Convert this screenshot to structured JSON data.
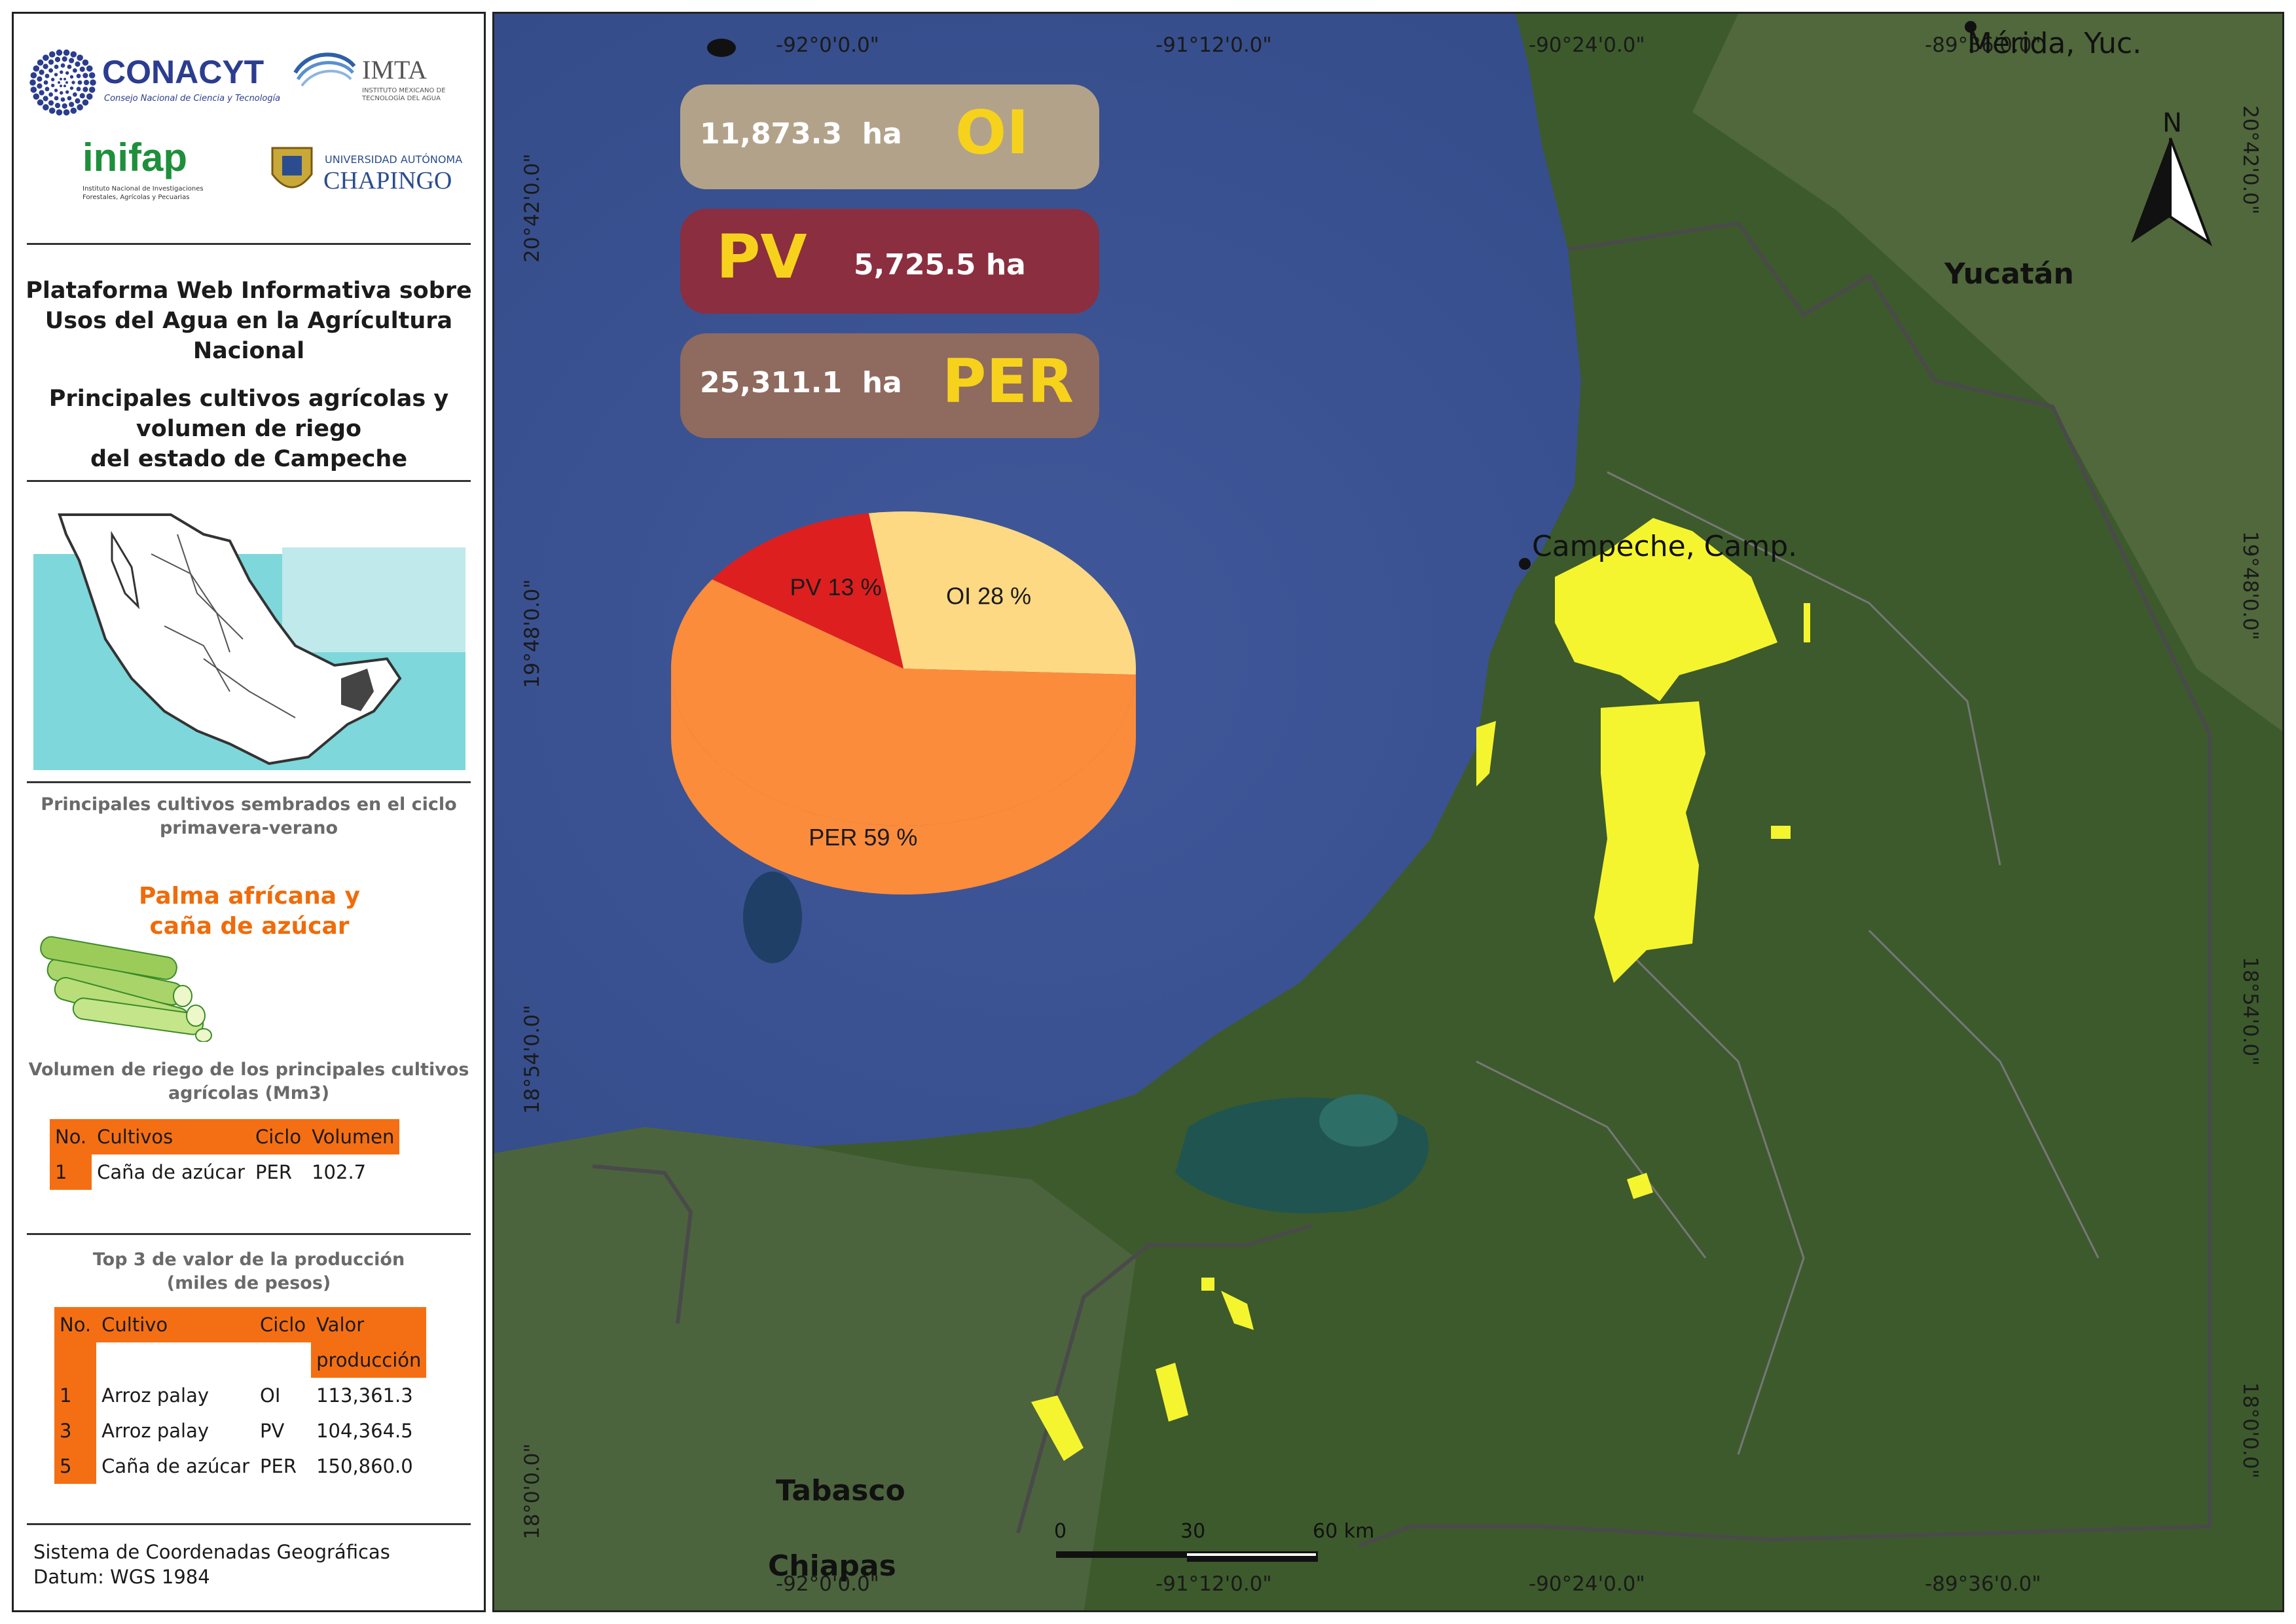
{
  "logos": {
    "conacyt": {
      "name": "CONACYT",
      "sub": "Consejo Nacional de Ciencia y Tecnología"
    },
    "imta": {
      "name": "IMTA",
      "sub": "INSTITUTO MEXICANO DE TECNOLOGÍA DEL AGUA"
    },
    "inifap": {
      "name": "inifap",
      "sub": "Instituto Nacional de Investigaciones Forestales, Agrícolas y Pecuarias"
    },
    "chapingo": {
      "name": "CHAPINGO",
      "sub": "UNIVERSIDAD AUTÓNOMA"
    }
  },
  "panel": {
    "title_lines": [
      "Plataforma Web Informativa sobre",
      "Usos del Agua en la Agrícultura",
      "Nacional"
    ],
    "subtitle_lines": [
      "Principales cultivos agrícolas y",
      "volumen de riego",
      "del estado de Campeche"
    ],
    "crops_heading": [
      "Principales cultivos sembrados en el ciclo",
      "primavera-verano"
    ],
    "crops": [
      "Palma afrícana y",
      "caña de azúcar"
    ],
    "volume_heading": [
      "Volumen de riego de los principales cultivos",
      "agrícolas (Mm3)"
    ],
    "volume_table": {
      "headers": [
        "No.",
        "Cultivos",
        "Ciclo",
        "Volumen"
      ],
      "rows": [
        [
          "1",
          "Caña de azúcar",
          "PER",
          "102.7"
        ]
      ]
    },
    "top_heading": [
      "Top 3 de valor de la producción",
      "(miles de pesos)"
    ],
    "top_table": {
      "headers": [
        "No.",
        "Cultivo",
        "Ciclo",
        "Valor",
        "producción"
      ],
      "rows": [
        [
          "1",
          "Arroz palay",
          "OI",
          "113,361.3"
        ],
        [
          "3",
          "Arroz palay",
          "PV",
          "104,364.5"
        ],
        [
          "5",
          "Caña de azúcar",
          "PER",
          "150,860.0"
        ]
      ]
    },
    "footer": [
      "Sistema de Coordenadas Geográficas",
      "Datum: WGS 1984"
    ]
  },
  "map": {
    "top_coords": [
      "-92°0'0.0\"",
      "-91°12'0.0\"",
      "-90°24'0.0\"",
      "-89°36'0.0\""
    ],
    "bottom_coords": [
      "-92°0'0.0\"",
      "-91°12'0.0\"",
      "-90°24'0.0\"",
      "-89°36'0.0\""
    ],
    "left_coords": [
      "20°42'0.0\"",
      "19°48'0.0\"",
      "18°54'0.0\"",
      "18°0'0.0\""
    ],
    "right_coords": [
      "20°42'0.0\"",
      "19°48'0.0\"",
      "18°54'0.0\"",
      "18°0'0.0\""
    ],
    "north_label": "N",
    "places": {
      "merida": "Mérida, Yuc.",
      "campeche": "Campeche, Camp.",
      "yucatan": "Yucatán",
      "tabasco": "Tabasco",
      "chiapas": "Chiapas"
    },
    "scale": {
      "labels": [
        "0",
        "30",
        "60 km"
      ]
    },
    "areas": [
      {
        "value": "11,873.3",
        "unit": "ha",
        "code": "OI",
        "color": "#b3a28a"
      },
      {
        "value": "5,725.5",
        "unit": "ha",
        "code": "PV",
        "color": "#8b2e3f"
      },
      {
        "value": "25,311.1",
        "unit": "ha",
        "code": "PER",
        "color": "#8f6a5e"
      }
    ]
  },
  "chart_data": {
    "type": "pie",
    "slices": [
      {
        "label": "OI",
        "value": 28,
        "color": "#fdd984"
      },
      {
        "label": "PER",
        "value": 59,
        "color": "#fb8c3c"
      },
      {
        "label": "PV",
        "value": 13,
        "color": "#de1f1f"
      }
    ],
    "slice_labels": [
      "OI 28 %",
      "PER 59 %",
      "PV 13 %"
    ]
  }
}
